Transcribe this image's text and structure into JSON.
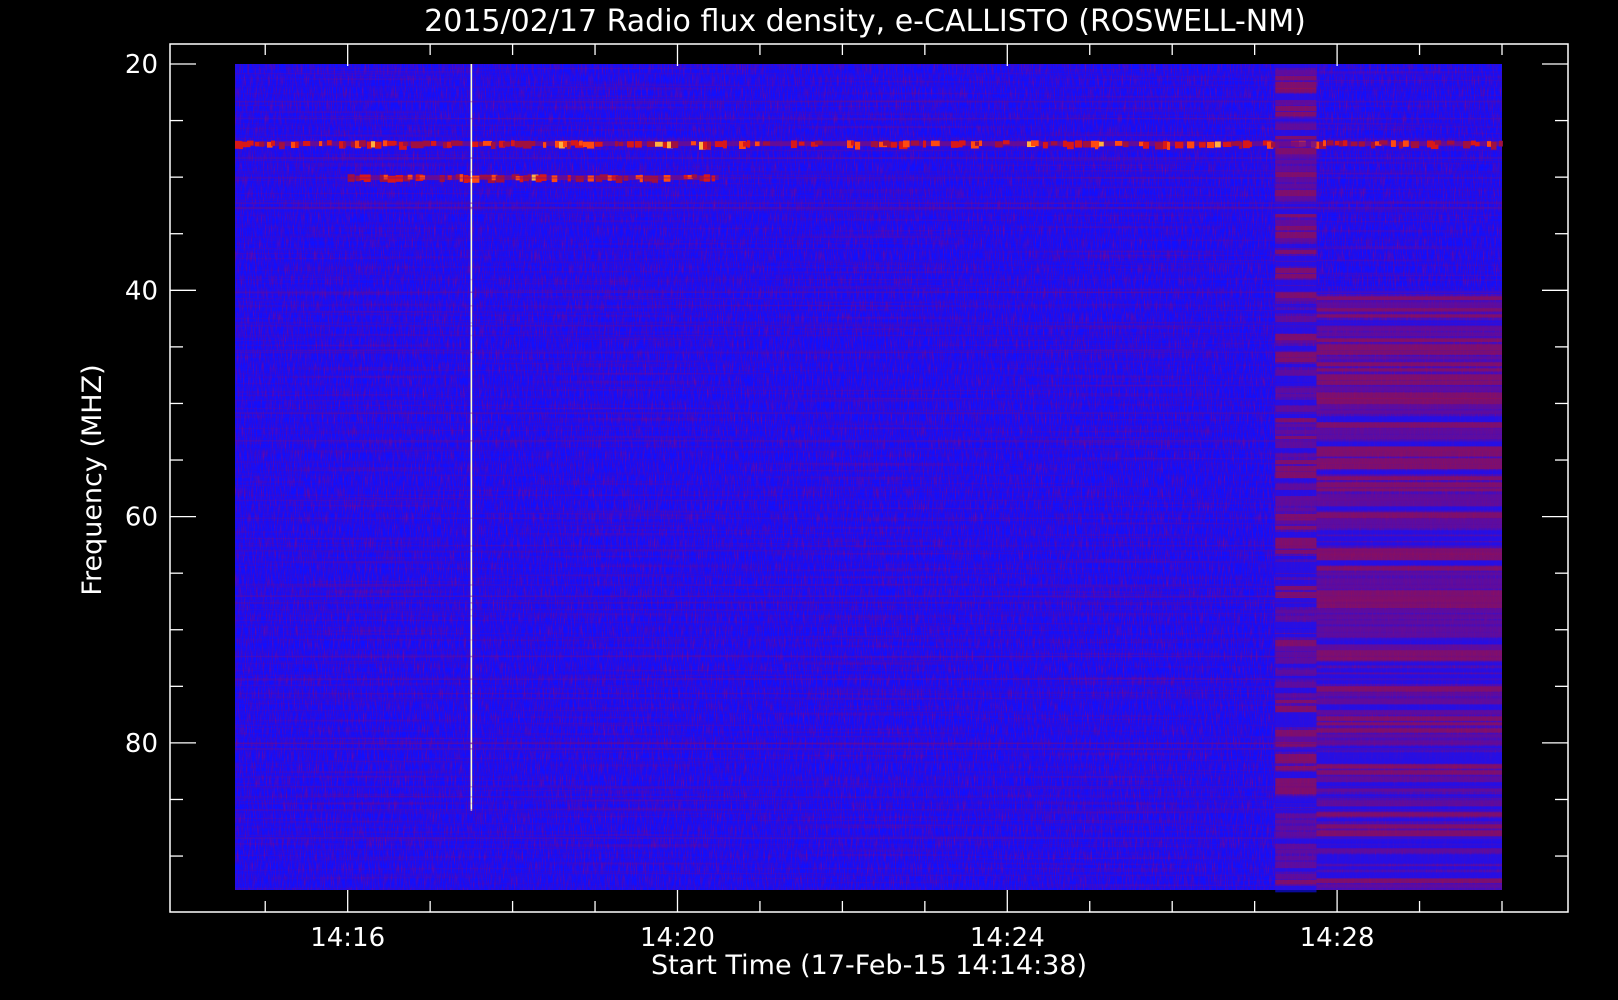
{
  "chart_data": {
    "type": "heatmap",
    "title": "2015/02/17  Radio flux density, e-CALLISTO (ROSWELL-NM)",
    "xlabel": "Start Time (17-Feb-15 14:14:38)",
    "ylabel": "Frequency (MHZ)",
    "x_unit": "time (HH:MM, UT)",
    "xlim": [
      "14:14:38",
      "14:30:00"
    ],
    "ylim": [
      93,
      20
    ],
    "y_inverted": true,
    "x_ticks": [
      {
        "value": "14:16",
        "label": "14:16"
      },
      {
        "value": "14:20",
        "label": "14:20"
      },
      {
        "value": "14:24",
        "label": "14:24"
      },
      {
        "value": "14:28",
        "label": "14:28"
      }
    ],
    "y_ticks": [
      {
        "value": 20,
        "label": "20"
      },
      {
        "value": 40,
        "label": "40"
      },
      {
        "value": 60,
        "label": "60"
      },
      {
        "value": 80,
        "label": "80"
      }
    ],
    "grid": false,
    "legend": "none",
    "colormap": [
      "#1010ff",
      "#3a10d0",
      "#6a0c90",
      "#a01040",
      "#d81818",
      "#ff4a10",
      "#ffb040",
      "#ffffc8"
    ],
    "background_value_color": "#1010ff",
    "features": [
      {
        "name": "bright band near 27 MHz",
        "freq_mhz": 27,
        "start": "14:14:38",
        "end": "14:30:00",
        "intensity": "high"
      },
      {
        "name": "bright band near 30 MHz",
        "freq_mhz": 30,
        "start": "14:16:00",
        "end": "14:20:30",
        "intensity": "high"
      },
      {
        "name": "vertical spike",
        "time": "14:17:30",
        "freq_range_mhz": [
          20,
          86
        ],
        "intensity": "max"
      },
      {
        "name": "broadband interference",
        "start": "14:27:15",
        "end": "14:27:45",
        "freq_range_mhz": [
          20,
          93
        ],
        "intensity": "medium"
      },
      {
        "name": "elevated background",
        "start": "14:27:45",
        "end": "14:30:00",
        "freq_range_mhz": [
          40,
          93
        ],
        "intensity": "medium"
      }
    ]
  }
}
